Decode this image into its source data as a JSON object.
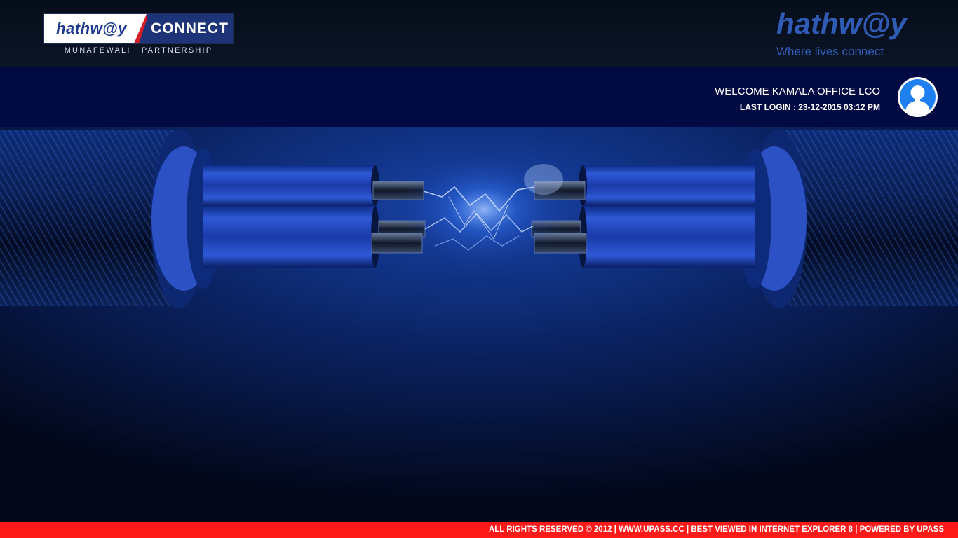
{
  "header": {
    "connect_logo": {
      "left_text": "hathw@y",
      "right_text": "CONNECT"
    },
    "tagline": "MUNAFEWALI PARTNERSHIP",
    "brand_logo": "hathw@y",
    "brand_slogan": "Where lives connect"
  },
  "user": {
    "welcome": "WELCOME KAMALA OFFICE LCO",
    "last_login": "LAST LOGIN : 23-12-2015 03:12 PM",
    "avatar_icon": "user-avatar-icon"
  },
  "hero": {
    "image_icon": "cable-connection-illustration"
  },
  "footer": {
    "text": "ALL RIGHTS RESERVED © 2012 | WWW.UPASS.CC | BEST VIEWED IN INTERNET EXPLORER 8 | POWERED BY UPASS"
  },
  "colors": {
    "brand_blue": "#2f5bb5",
    "welcome_bar": "#020a43",
    "footer_red": "#ff1a1a",
    "avatar_blue": "#1e7ff0"
  }
}
